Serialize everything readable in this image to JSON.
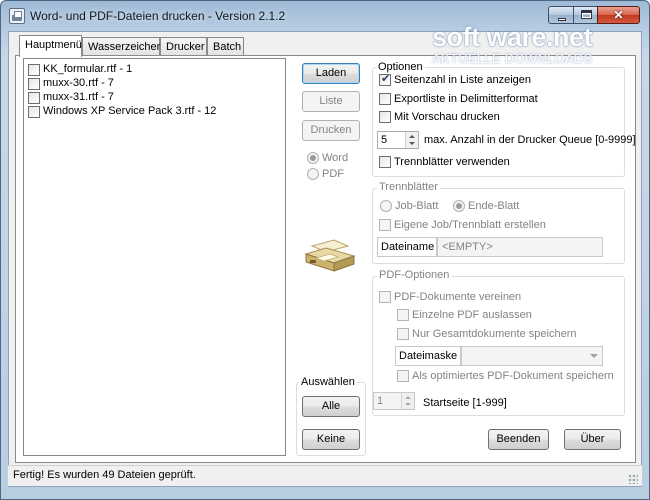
{
  "window": {
    "title": "Word- und PDF-Dateien drucken - Version  2.1.2",
    "watermark_brand": "soft ware.net",
    "watermark_tagline": "AKTUELLE DOWNLOADS"
  },
  "tabs": [
    {
      "label": "Hauptmenü",
      "active": true
    },
    {
      "label": "Wasserzeichen",
      "active": false
    },
    {
      "label": "Drucker",
      "active": false
    },
    {
      "label": "Batch",
      "active": false
    }
  ],
  "file_list": [
    {
      "label": "KK_formular.rtf - 1",
      "checked": false
    },
    {
      "label": "muxx-30.rtf - 7",
      "checked": false
    },
    {
      "label": "muxx-31.rtf - 7",
      "checked": false
    },
    {
      "label": "Windows XP Service Pack 3.rtf - 12",
      "checked": false
    }
  ],
  "actions": {
    "load": "Laden",
    "list": "Liste",
    "print": "Drucken",
    "mode_word": "Word",
    "mode_pdf": "PDF",
    "selected_mode": "Word"
  },
  "select_group": {
    "title": "Auswählen",
    "all": "Alle",
    "none": "Keine"
  },
  "options": {
    "title": "Optionen",
    "show_page_count": {
      "label": "Seitenzahl in Liste anzeigen",
      "checked": true
    },
    "export_list": {
      "label": "Exportliste in Delimitterformat",
      "checked": false
    },
    "preview": {
      "label": "Mit Vorschau drucken",
      "checked": false
    },
    "queue_value": "5",
    "queue_label": "max. Anzahl in der Drucker Queue [0-9999]",
    "separator_sheets": {
      "label": "Trennblätter verwenden",
      "checked": false
    }
  },
  "separator": {
    "title": "Trennblätter",
    "job_sheet": "Job-Blatt",
    "end_sheet": "Ende-Blatt",
    "selected": "Ende-Blatt",
    "custom": {
      "label": "Eigene Job/Trennblatt erstellen",
      "checked": false
    },
    "filename_label": "Dateiname",
    "filename_value": "<EMPTY>"
  },
  "pdf_options": {
    "title": "PDF-Optionen",
    "merge": {
      "label": "PDF-Dokumente vereinen",
      "checked": false
    },
    "skip_single": {
      "label": "Einzelne PDF auslassen",
      "checked": false
    },
    "only_total": {
      "label": "Nur Gesamtdokumente speichern",
      "checked": false
    },
    "mask_label": "Dateimaske",
    "mask_value": "",
    "optimized": {
      "label": "Als optimiertes PDF-Dokument speichern",
      "checked": false
    },
    "start_page_value": "1",
    "start_page_label": "Startseite [1-999]"
  },
  "footer": {
    "quit": "Beenden",
    "about": "Über"
  },
  "status": "Fertig! Es wurden 49 Dateien geprüft."
}
